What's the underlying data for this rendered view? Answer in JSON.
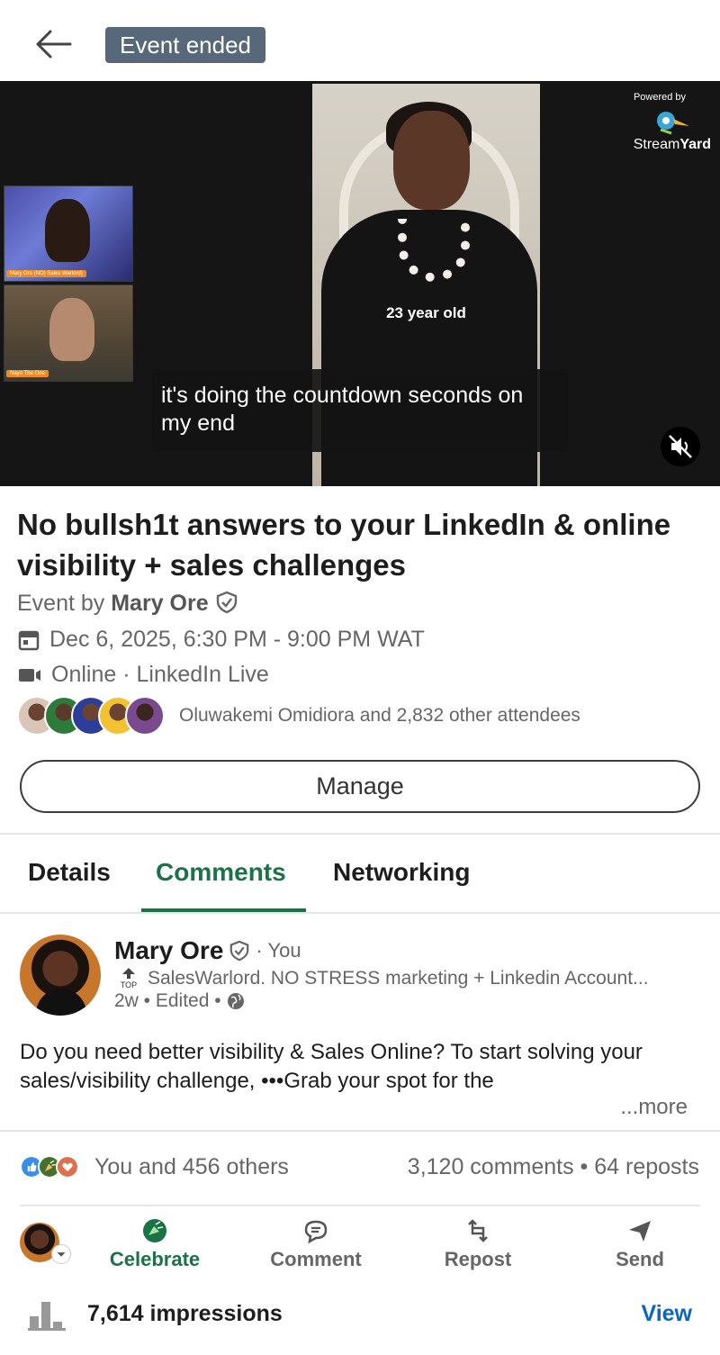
{
  "header": {
    "badge": "Event ended"
  },
  "video": {
    "powered_by": "Powered by",
    "brand_name_light": "Stream",
    "brand_name_bold": "Yard",
    "overlay_text": "23 year old",
    "caption": "it's doing the countdown seconds on my end",
    "guest1_tag": "Mary Ore (NO) Sales Warlord)",
    "guest2_tag": "Nayo The One"
  },
  "event": {
    "title": "No bullsh1t answers to your LinkedIn & online visibility + sales challenges",
    "by_prefix": "Event by",
    "organizer": "Mary Ore",
    "datetime": "Dec 6, 2025, 6:30 PM - 9:00 PM WAT",
    "location": "Online · LinkedIn Live",
    "attendees": "Oluwakemi Omidiora and 2,832 other attendees",
    "manage_label": "Manage"
  },
  "tabs": [
    {
      "label": "Details"
    },
    {
      "label": "Comments"
    },
    {
      "label": "Networking"
    }
  ],
  "post": {
    "author": "Mary Ore",
    "you": "· You",
    "top_badge": "TOP",
    "headline": "SalesWarlord. NO STRESS marketing + Linkedin Account...",
    "time": "2w • Edited •",
    "body": "Do you need better visibility & Sales Online? To start solving your sales/visibility challenge, •••Grab your spot for the",
    "more": "...more",
    "likes": "You and 456 others",
    "counts": "3,120 comments  •  64 reposts"
  },
  "actions": {
    "celebrate": "Celebrate",
    "comment": "Comment",
    "repost": "Repost",
    "send": "Send"
  },
  "impressions": {
    "text": "7,614 impressions",
    "view": "View"
  },
  "colors": {
    "accent_green": "#1a7247",
    "link_blue": "#0a66c2",
    "badge_bg": "#56687a"
  }
}
